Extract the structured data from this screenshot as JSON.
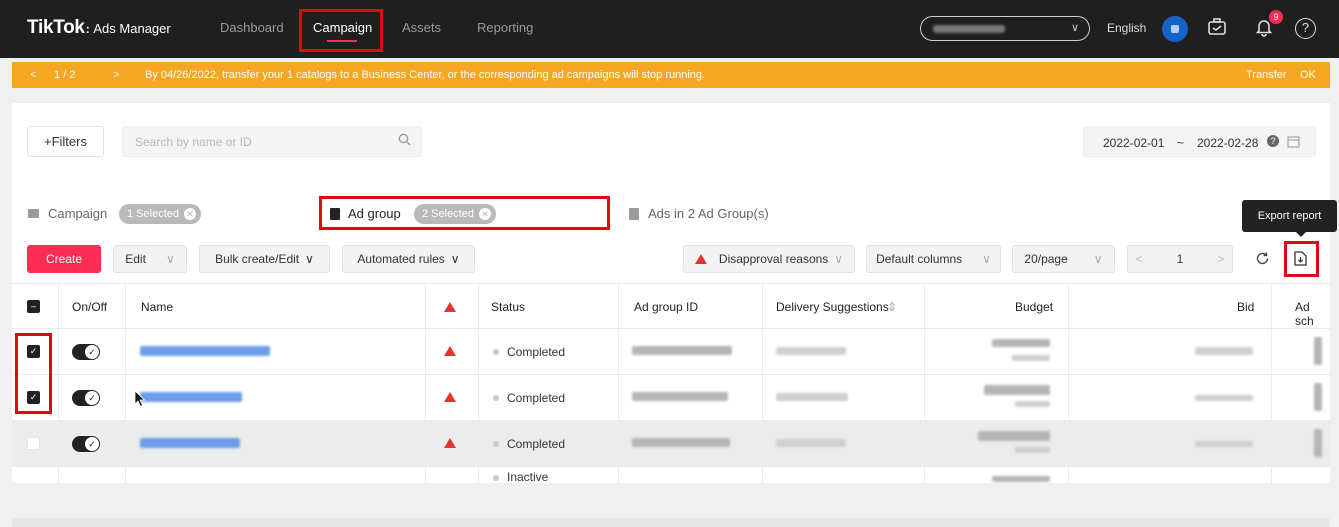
{
  "header": {
    "logo_main": "TikTok",
    "logo_sub": "Ads Manager",
    "nav": [
      "Dashboard",
      "Campaign",
      "Assets",
      "Reporting"
    ],
    "active_nav": "Campaign",
    "language": "English",
    "notification_count": "9",
    "help_glyph": "?"
  },
  "notice": {
    "prev": "<",
    "pager": "1  /  2",
    "next": ">",
    "message": "By 04/26/2022, transfer your 1 catalogs to a Business Center, or the corresponding ad campaigns will stop running.",
    "transfer": "Transfer",
    "ok": "OK"
  },
  "filters": {
    "filters_label": "+Filters",
    "search_placeholder": "Search by name or ID",
    "date_start": "2022-02-01",
    "date_sep": "~",
    "date_end": "2022-02-28"
  },
  "levels": {
    "campaign_label": "Campaign",
    "campaign_chip": "1 Selected",
    "adgroup_label": "Ad group",
    "adgroup_chip": "2 Selected",
    "ads_label": "Ads in 2 Ad Group(s)"
  },
  "tooltip": "Export report",
  "toolbar": {
    "create": "Create",
    "edit": "Edit",
    "bulk": "Bulk create/Edit",
    "rules": "Automated rules",
    "disapproval": "Disapproval reasons",
    "columns": "Default columns",
    "per_page": "20/page",
    "page_num": "1",
    "pager_prev": "<",
    "pager_next": ">"
  },
  "table": {
    "headers": {
      "onoff": "On/Off",
      "name": "Name",
      "status": "Status",
      "adgroup_id": "Ad group ID",
      "delivery": "Delivery Suggestions",
      "budget": "Budget",
      "bid": "Bid",
      "schedule": "Ad sch"
    },
    "rows": [
      {
        "status": "Completed"
      },
      {
        "status": "Completed"
      },
      {
        "status": "Completed"
      },
      {
        "status": "Inactive"
      }
    ]
  },
  "colors": {
    "accent": "#fe2c55",
    "notice": "#f5a623",
    "highlight": "#e30613"
  },
  "icons": [
    "search-icon",
    "calendar-icon",
    "help-circle-icon",
    "bell-icon",
    "briefcase-icon",
    "refresh-icon",
    "export-icon",
    "warning-icon"
  ]
}
